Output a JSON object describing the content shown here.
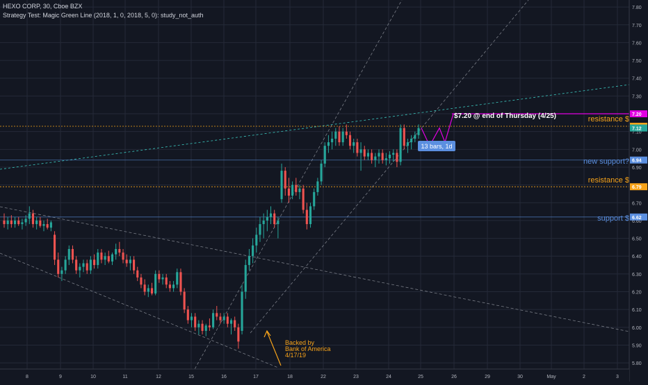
{
  "header": {
    "title": "HEXO CORP, 30, Cboe BZX",
    "study": "Strategy Test: Magic Green Line (2018, 1, 0, 2018, 5, 0): study_not_auth"
  },
  "colors": {
    "background": "#131722",
    "grid": "#242a38",
    "up": "#26a69a",
    "down": "#ef5350",
    "axis_text": "#b2b5be",
    "resistance": "#f7a31a",
    "support": "#5b8fe0",
    "target": "#e200e2",
    "channel": "#9598a1",
    "trend": "#3cc9c0"
  },
  "chart_data": {
    "type": "candlestick",
    "symbol": "HEXO CORP",
    "interval": "30",
    "exchange": "Cboe BZX",
    "ylim": [
      5.75,
      7.82
    ],
    "y_ticks": [
      5.8,
      5.9,
      6.0,
      6.1,
      6.2,
      6.3,
      6.4,
      6.5,
      6.6,
      6.7,
      6.8,
      6.9,
      7.0,
      7.1,
      7.2,
      7.3,
      7.4,
      7.5,
      7.6,
      7.7,
      7.8
    ],
    "x_ticks": [
      "8",
      "9",
      "10",
      "11",
      "12",
      "15",
      "16",
      "17",
      "18",
      "22",
      "23",
      "24",
      "25",
      "26",
      "29",
      "30",
      "May",
      "2",
      "3"
    ],
    "candles": [
      {
        "o": 6.6,
        "h": 6.64,
        "l": 6.56,
        "c": 6.58
      },
      {
        "o": 6.58,
        "h": 6.62,
        "l": 6.55,
        "c": 6.6
      },
      {
        "o": 6.6,
        "h": 6.63,
        "l": 6.56,
        "c": 6.58
      },
      {
        "o": 6.58,
        "h": 6.62,
        "l": 6.56,
        "c": 6.6
      },
      {
        "o": 6.6,
        "h": 6.62,
        "l": 6.57,
        "c": 6.58
      },
      {
        "o": 6.58,
        "h": 6.61,
        "l": 6.55,
        "c": 6.59
      },
      {
        "o": 6.59,
        "h": 6.63,
        "l": 6.57,
        "c": 6.61
      },
      {
        "o": 6.61,
        "h": 6.68,
        "l": 6.58,
        "c": 6.64
      },
      {
        "o": 6.64,
        "h": 6.66,
        "l": 6.56,
        "c": 6.58
      },
      {
        "o": 6.58,
        "h": 6.62,
        "l": 6.55,
        "c": 6.6
      },
      {
        "o": 6.6,
        "h": 6.62,
        "l": 6.56,
        "c": 6.57
      },
      {
        "o": 6.57,
        "h": 6.6,
        "l": 6.54,
        "c": 6.58
      },
      {
        "o": 6.58,
        "h": 6.61,
        "l": 6.55,
        "c": 6.56
      },
      {
        "o": 6.56,
        "h": 6.6,
        "l": 6.54,
        "c": 6.59
      },
      {
        "o": 6.52,
        "h": 6.54,
        "l": 6.35,
        "c": 6.38
      },
      {
        "o": 6.38,
        "h": 6.42,
        "l": 6.28,
        "c": 6.3
      },
      {
        "o": 6.3,
        "h": 6.34,
        "l": 6.26,
        "c": 6.32
      },
      {
        "o": 6.32,
        "h": 6.4,
        "l": 6.3,
        "c": 6.38
      },
      {
        "o": 6.38,
        "h": 6.46,
        "l": 6.35,
        "c": 6.44
      },
      {
        "o": 6.44,
        "h": 6.46,
        "l": 6.36,
        "c": 6.38
      },
      {
        "o": 6.38,
        "h": 6.4,
        "l": 6.3,
        "c": 6.32
      },
      {
        "o": 6.32,
        "h": 6.36,
        "l": 6.28,
        "c": 6.34
      },
      {
        "o": 6.34,
        "h": 6.38,
        "l": 6.31,
        "c": 6.36
      },
      {
        "o": 6.36,
        "h": 6.38,
        "l": 6.3,
        "c": 6.32
      },
      {
        "o": 6.32,
        "h": 6.4,
        "l": 6.3,
        "c": 6.38
      },
      {
        "o": 6.38,
        "h": 6.41,
        "l": 6.33,
        "c": 6.35
      },
      {
        "o": 6.35,
        "h": 6.44,
        "l": 6.33,
        "c": 6.42
      },
      {
        "o": 6.42,
        "h": 6.44,
        "l": 6.36,
        "c": 6.38
      },
      {
        "o": 6.38,
        "h": 6.42,
        "l": 6.35,
        "c": 6.4
      },
      {
        "o": 6.4,
        "h": 6.43,
        "l": 6.36,
        "c": 6.37
      },
      {
        "o": 6.37,
        "h": 6.42,
        "l": 6.35,
        "c": 6.41
      },
      {
        "o": 6.41,
        "h": 6.47,
        "l": 6.38,
        "c": 6.44
      },
      {
        "o": 6.44,
        "h": 6.48,
        "l": 6.4,
        "c": 6.42
      },
      {
        "o": 6.42,
        "h": 6.44,
        "l": 6.36,
        "c": 6.38
      },
      {
        "o": 6.38,
        "h": 6.41,
        "l": 6.34,
        "c": 6.36
      },
      {
        "o": 6.36,
        "h": 6.4,
        "l": 6.32,
        "c": 6.38
      },
      {
        "o": 6.38,
        "h": 6.4,
        "l": 6.3,
        "c": 6.32
      },
      {
        "o": 6.32,
        "h": 6.34,
        "l": 6.26,
        "c": 6.28
      },
      {
        "o": 6.28,
        "h": 6.3,
        "l": 6.22,
        "c": 6.24
      },
      {
        "o": 6.24,
        "h": 6.27,
        "l": 6.18,
        "c": 6.2
      },
      {
        "o": 6.2,
        "h": 6.24,
        "l": 6.17,
        "c": 6.22
      },
      {
        "o": 6.22,
        "h": 6.25,
        "l": 6.18,
        "c": 6.19
      },
      {
        "o": 6.19,
        "h": 6.32,
        "l": 6.18,
        "c": 6.3
      },
      {
        "o": 6.3,
        "h": 6.32,
        "l": 6.25,
        "c": 6.27
      },
      {
        "o": 6.27,
        "h": 6.3,
        "l": 6.24,
        "c": 6.28
      },
      {
        "o": 6.28,
        "h": 6.3,
        "l": 6.22,
        "c": 6.24
      },
      {
        "o": 6.24,
        "h": 6.26,
        "l": 6.2,
        "c": 6.22
      },
      {
        "o": 6.22,
        "h": 6.26,
        "l": 6.2,
        "c": 6.24
      },
      {
        "o": 6.24,
        "h": 6.33,
        "l": 6.22,
        "c": 6.31
      },
      {
        "o": 6.31,
        "h": 6.33,
        "l": 6.18,
        "c": 6.2
      },
      {
        "o": 6.2,
        "h": 6.22,
        "l": 6.08,
        "c": 6.1
      },
      {
        "o": 6.1,
        "h": 6.12,
        "l": 6.02,
        "c": 6.04
      },
      {
        "o": 6.04,
        "h": 6.08,
        "l": 6.0,
        "c": 6.06
      },
      {
        "o": 6.06,
        "h": 6.08,
        "l": 5.98,
        "c": 6.0
      },
      {
        "o": 6.0,
        "h": 6.04,
        "l": 5.96,
        "c": 6.02
      },
      {
        "o": 6.02,
        "h": 6.04,
        "l": 5.96,
        "c": 5.98
      },
      {
        "o": 5.98,
        "h": 6.02,
        "l": 5.95,
        "c": 6.01
      },
      {
        "o": 6.01,
        "h": 6.05,
        "l": 5.98,
        "c": 6.0
      },
      {
        "o": 6.0,
        "h": 6.1,
        "l": 5.99,
        "c": 6.08
      },
      {
        "o": 6.08,
        "h": 6.12,
        "l": 6.04,
        "c": 6.06
      },
      {
        "o": 6.06,
        "h": 6.08,
        "l": 6.02,
        "c": 6.04
      },
      {
        "o": 6.04,
        "h": 6.08,
        "l": 6.02,
        "c": 6.06
      },
      {
        "o": 6.06,
        "h": 6.08,
        "l": 6.0,
        "c": 6.02
      },
      {
        "o": 6.02,
        "h": 6.05,
        "l": 5.96,
        "c": 6.04
      },
      {
        "o": 6.04,
        "h": 6.06,
        "l": 5.98,
        "c": 6.0
      },
      {
        "o": 6.0,
        "h": 6.02,
        "l": 5.88,
        "c": 5.92
      },
      {
        "o": 5.98,
        "h": 6.24,
        "l": 5.96,
        "c": 6.2
      },
      {
        "o": 6.2,
        "h": 6.38,
        "l": 6.16,
        "c": 6.35
      },
      {
        "o": 6.35,
        "h": 6.44,
        "l": 6.32,
        "c": 6.4
      },
      {
        "o": 6.4,
        "h": 6.5,
        "l": 6.36,
        "c": 6.46
      },
      {
        "o": 6.46,
        "h": 6.56,
        "l": 6.42,
        "c": 6.52
      },
      {
        "o": 6.52,
        "h": 6.62,
        "l": 6.48,
        "c": 6.58
      },
      {
        "o": 6.58,
        "h": 6.64,
        "l": 6.5,
        "c": 6.6
      },
      {
        "o": 6.6,
        "h": 6.66,
        "l": 6.54,
        "c": 6.62
      },
      {
        "o": 6.62,
        "h": 6.68,
        "l": 6.58,
        "c": 6.64
      },
      {
        "o": 6.64,
        "h": 6.66,
        "l": 6.56,
        "c": 6.58
      },
      {
        "o": 6.58,
        "h": 6.62,
        "l": 6.5,
        "c": 6.6
      },
      {
        "o": 6.72,
        "h": 6.92,
        "l": 6.7,
        "c": 6.88
      },
      {
        "o": 6.88,
        "h": 6.9,
        "l": 6.74,
        "c": 6.78
      },
      {
        "o": 6.78,
        "h": 6.84,
        "l": 6.7,
        "c": 6.74
      },
      {
        "o": 6.74,
        "h": 6.82,
        "l": 6.72,
        "c": 6.8
      },
      {
        "o": 6.8,
        "h": 6.84,
        "l": 6.74,
        "c": 6.76
      },
      {
        "o": 6.76,
        "h": 6.8,
        "l": 6.72,
        "c": 6.78
      },
      {
        "o": 6.78,
        "h": 6.8,
        "l": 6.64,
        "c": 6.66
      },
      {
        "o": 6.66,
        "h": 6.7,
        "l": 6.55,
        "c": 6.58
      },
      {
        "o": 6.58,
        "h": 6.7,
        "l": 6.56,
        "c": 6.68
      },
      {
        "o": 6.68,
        "h": 6.78,
        "l": 6.66,
        "c": 6.76
      },
      {
        "o": 6.76,
        "h": 6.84,
        "l": 6.74,
        "c": 6.82
      },
      {
        "o": 6.82,
        "h": 6.94,
        "l": 6.8,
        "c": 6.92
      },
      {
        "o": 6.92,
        "h": 7.04,
        "l": 6.9,
        "c": 7.02
      },
      {
        "o": 7.02,
        "h": 7.08,
        "l": 6.98,
        "c": 7.04
      },
      {
        "o": 7.04,
        "h": 7.1,
        "l": 7.0,
        "c": 7.06
      },
      {
        "o": 7.06,
        "h": 7.12,
        "l": 7.02,
        "c": 7.1
      },
      {
        "o": 7.1,
        "h": 7.13,
        "l": 7.02,
        "c": 7.04
      },
      {
        "o": 7.04,
        "h": 7.12,
        "l": 7.02,
        "c": 7.1
      },
      {
        "o": 7.1,
        "h": 7.14,
        "l": 7.06,
        "c": 7.08
      },
      {
        "o": 7.08,
        "h": 7.1,
        "l": 7.0,
        "c": 7.02
      },
      {
        "o": 7.02,
        "h": 7.06,
        "l": 6.98,
        "c": 7.04
      },
      {
        "o": 7.04,
        "h": 7.06,
        "l": 6.96,
        "c": 6.98
      },
      {
        "o": 6.98,
        "h": 7.04,
        "l": 6.88,
        "c": 7.0
      },
      {
        "o": 7.0,
        "h": 7.02,
        "l": 6.94,
        "c": 6.96
      },
      {
        "o": 6.96,
        "h": 7.0,
        "l": 6.94,
        "c": 6.98
      },
      {
        "o": 6.98,
        "h": 7.0,
        "l": 6.92,
        "c": 6.94
      },
      {
        "o": 6.94,
        "h": 6.98,
        "l": 6.9,
        "c": 6.96
      },
      {
        "o": 6.96,
        "h": 7.0,
        "l": 6.92,
        "c": 6.98
      },
      {
        "o": 6.98,
        "h": 7.0,
        "l": 6.92,
        "c": 6.94
      },
      {
        "o": 6.94,
        "h": 6.98,
        "l": 6.91,
        "c": 6.95
      },
      {
        "o": 6.95,
        "h": 6.99,
        "l": 6.92,
        "c": 6.97
      },
      {
        "o": 6.97,
        "h": 7.0,
        "l": 6.93,
        "c": 6.98
      },
      {
        "o": 6.98,
        "h": 7.0,
        "l": 6.9,
        "c": 6.93
      },
      {
        "o": 6.93,
        "h": 7.14,
        "l": 6.91,
        "c": 7.12
      },
      {
        "o": 7.12,
        "h": 7.14,
        "l": 7.0,
        "c": 7.02
      },
      {
        "o": 7.02,
        "h": 7.06,
        "l": 6.98,
        "c": 7.04
      },
      {
        "o": 7.04,
        "h": 7.08,
        "l": 7.0,
        "c": 7.06
      },
      {
        "o": 7.06,
        "h": 7.1,
        "l": 7.04,
        "c": 7.08
      },
      {
        "o": 7.08,
        "h": 7.14,
        "l": 7.06,
        "c": 7.12
      }
    ],
    "horizontal_levels": [
      {
        "name": "target",
        "value": 7.2,
        "text": "7.20",
        "color": "#e200e2"
      },
      {
        "name": "resistance-upper",
        "value": 7.13,
        "text": "7.13",
        "color": "#f7a31a"
      },
      {
        "name": "support-new",
        "value": 6.94,
        "text": "6.94",
        "color": "#5b8fe0"
      },
      {
        "name": "resistance-lower",
        "value": 6.79,
        "text": "6.79",
        "color": "#f7a31a"
      },
      {
        "name": "support",
        "value": 6.62,
        "text": "6.62",
        "color": "#5b8fe0"
      }
    ],
    "last_price": {
      "value": 7.12,
      "text": "7.12",
      "color": "#26a69a"
    },
    "annotations": {
      "resistance_upper": "resistance $",
      "new_support": "new support?",
      "resistance_lower": "resistance $",
      "support": "support $",
      "target_text": "$7.20 @ end of Thursday (4/25)",
      "projection_box": "13 bars, 1d",
      "backed_by": [
        "Backed by",
        "Bank of America",
        "4/17/19"
      ]
    }
  }
}
